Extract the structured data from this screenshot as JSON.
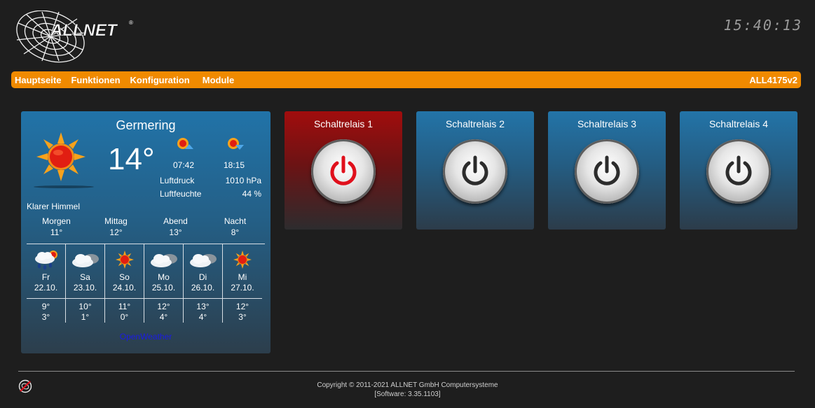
{
  "header": {
    "brand": "ALLNET",
    "clock": "15:40:13"
  },
  "nav": {
    "items": [
      "Hauptseite",
      "Funktionen",
      "Konfiguration",
      "Module"
    ],
    "device": "ALL4175v2"
  },
  "weather": {
    "city": "Germering",
    "icon": "sun-icon",
    "temperature": "14°",
    "sunrise": "07:42",
    "sunset": "18:15",
    "pressure_label": "Luftdruck",
    "pressure_value": "1010 hPa",
    "humidity_label": "Luftfeuchte",
    "humidity_value": "44 %",
    "condition": "Klarer Himmel",
    "dayparts": [
      {
        "name": "Morgen",
        "temp": "11°"
      },
      {
        "name": "Mittag",
        "temp": "12°"
      },
      {
        "name": "Abend",
        "temp": "13°"
      },
      {
        "name": "Nacht",
        "temp": "8°"
      }
    ],
    "forecast": [
      {
        "day": "Fr",
        "date": "22.10.",
        "max": "9°",
        "min": "3°",
        "icon": "rain-cloud-icon"
      },
      {
        "day": "Sa",
        "date": "23.10.",
        "max": "10°",
        "min": "1°",
        "icon": "cloud-icon"
      },
      {
        "day": "So",
        "date": "24.10.",
        "max": "11°",
        "min": "0°",
        "icon": "sun-icon"
      },
      {
        "day": "Mo",
        "date": "25.10.",
        "max": "12°",
        "min": "4°",
        "icon": "cloud-icon"
      },
      {
        "day": "Di",
        "date": "26.10.",
        "max": "13°",
        "min": "4°",
        "icon": "cloud-icon"
      },
      {
        "day": "Mi",
        "date": "27.10.",
        "max": "12°",
        "min": "3°",
        "icon": "sun-icon"
      }
    ],
    "provider": "OpenWeather"
  },
  "relays": [
    {
      "name": "Schaltrelais 1",
      "state": "on",
      "icon": "power-icon",
      "icon_color": "#e0101c"
    },
    {
      "name": "Schaltrelais 2",
      "state": "off",
      "icon": "power-icon",
      "icon_color": "#2c2c2c"
    },
    {
      "name": "Schaltrelais 3",
      "state": "off",
      "icon": "power-icon",
      "icon_color": "#2c2c2c"
    },
    {
      "name": "Schaltrelais 4",
      "state": "off",
      "icon": "power-icon",
      "icon_color": "#2c2c2c"
    }
  ],
  "colors": {
    "accent": "#f08a00",
    "background": "#1e1e1e",
    "panel_blue": "#2173a8",
    "relay_on": "#a10d0d"
  },
  "footer": {
    "copyright": "Copyright © 2011-2021 ALLNET GmbH Computersysteme",
    "software": "[Software: 3.35.1103]"
  }
}
